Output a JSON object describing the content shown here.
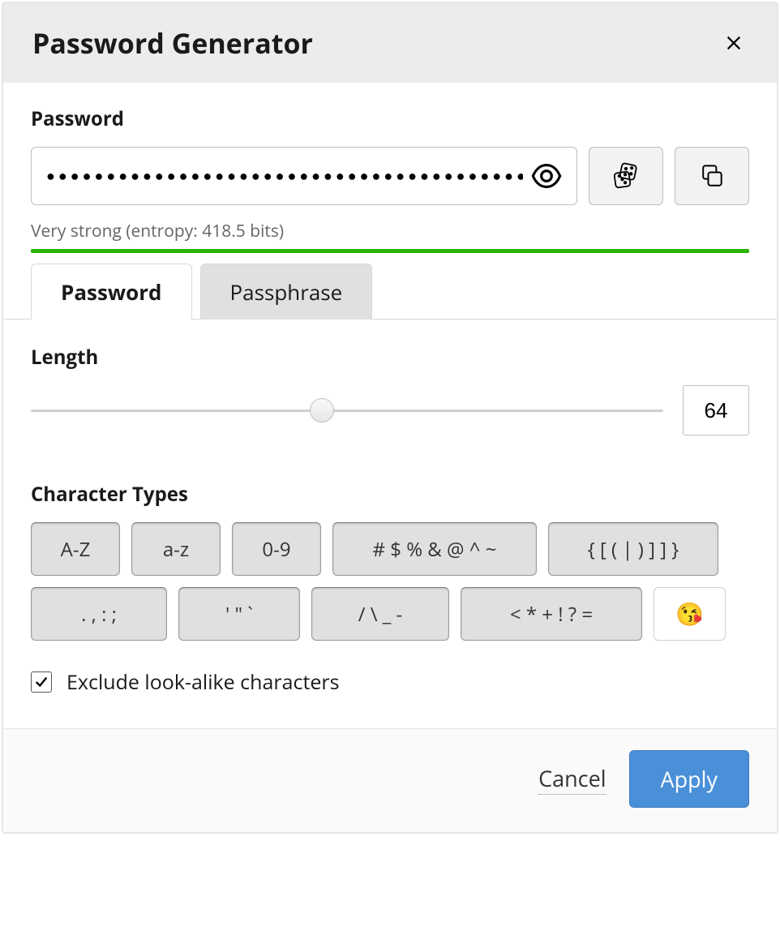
{
  "header": {
    "title": "Password Generator"
  },
  "password_section": {
    "label": "Password",
    "masked_value": "●●●●●●●●●●●●●●●●●●●●●●●●●●●●●●●●●●●●●●●●●●●●●●●●●●●●●●●●●●●●●●●●",
    "strength_text": "Very strong (entropy: 418.5 bits)"
  },
  "tabs": {
    "password": "Password",
    "passphrase": "Passphrase"
  },
  "length": {
    "label": "Length",
    "value": "64"
  },
  "char_types": {
    "label": "Character Types",
    "upper": "A-Z",
    "lower": "a-z",
    "digits": "0-9",
    "special1": "# $ % & @ ^ ~",
    "brackets": "{ [ ( | ) ] ] }",
    "punct": ". , : ;",
    "quotes": "' \" `",
    "slashes": "/ \\ _ -",
    "math": "< * + ! ? =",
    "emoji": "😘"
  },
  "exclude_lookalike": {
    "label": "Exclude look-alike characters",
    "checked": true
  },
  "footer": {
    "cancel": "Cancel",
    "apply": "Apply"
  }
}
